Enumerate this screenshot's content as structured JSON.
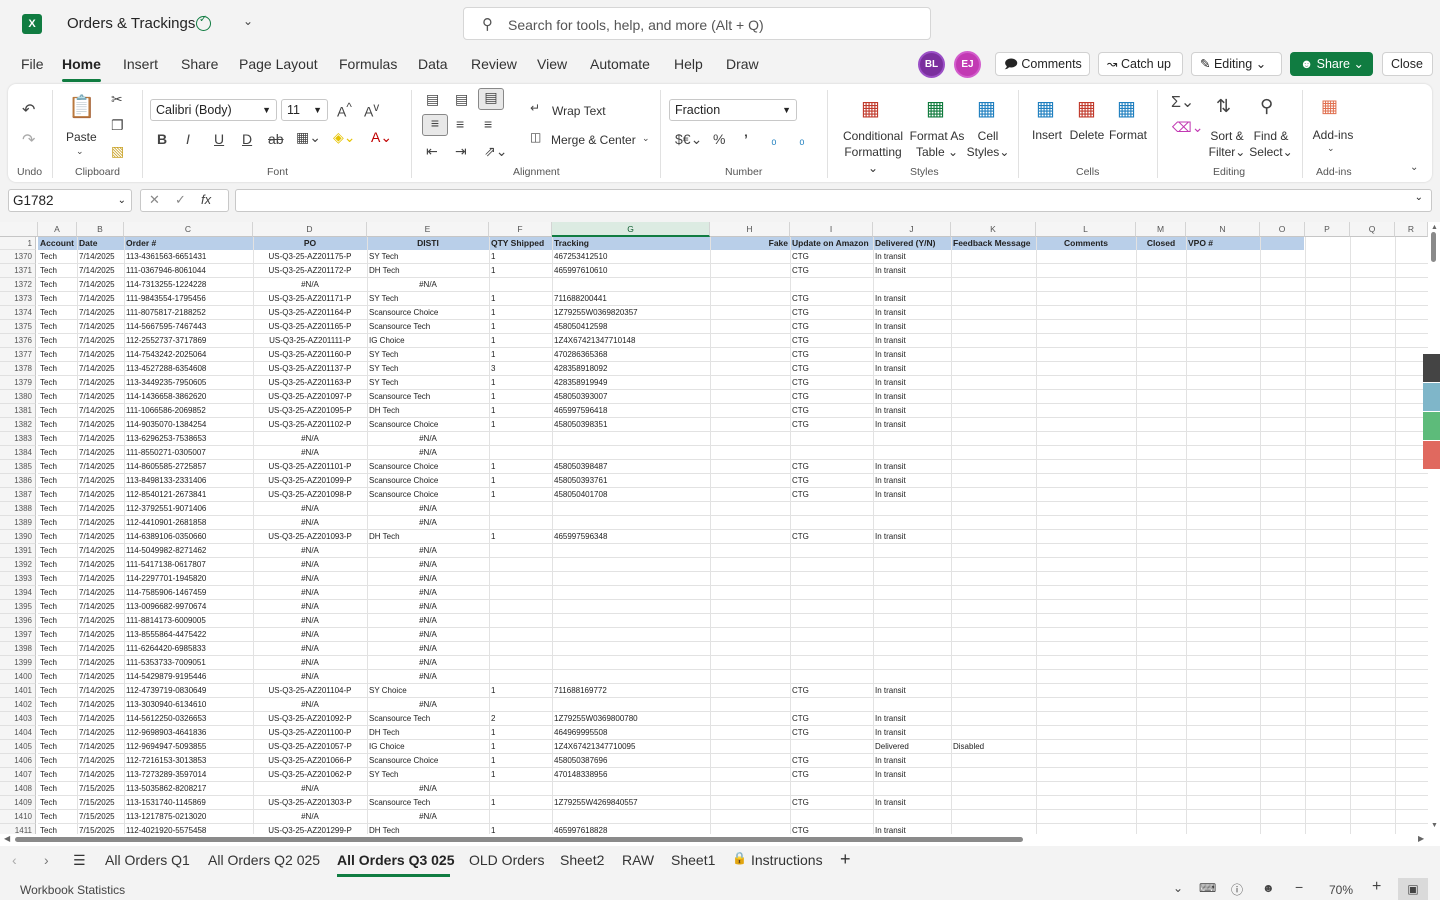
{
  "app": {
    "title": "Orders & Trackings",
    "logo": "X"
  },
  "search": {
    "placeholder": "Search for tools, help, and more (Alt + Q)"
  },
  "menu": [
    "File",
    "Home",
    "Insert",
    "Share",
    "Page Layout",
    "Formulas",
    "Data",
    "Review",
    "View",
    "Automate",
    "Help",
    "Draw"
  ],
  "active_menu": "Home",
  "avatars": [
    "BL",
    "EJ"
  ],
  "top_buttons": {
    "comments": "Comments",
    "catchup": "Catch up",
    "editing": "Editing",
    "share": "Share",
    "close": "Close"
  },
  "ribbon": {
    "undo_group": "Undo",
    "clipboard": {
      "paste": "Paste",
      "group": "Clipboard"
    },
    "font": {
      "name": "Calibri (Body)",
      "size": "11",
      "group": "Font"
    },
    "alignment": {
      "wrap": "Wrap Text",
      "merge": "Merge & Center",
      "group": "Alignment"
    },
    "number": {
      "format": "Fraction",
      "group": "Number"
    },
    "styles": {
      "conditional": "Conditional",
      "conditional2": "Formatting",
      "format_as": "Format As",
      "format_as2": "Table",
      "cell": "Cell",
      "cell2": "Styles",
      "group": "Styles"
    },
    "cells": {
      "insert": "Insert",
      "delete": "Delete",
      "format": "Format",
      "group": "Cells"
    },
    "editing": {
      "sort": "Sort &",
      "sort2": "Filter",
      "find": "Find &",
      "find2": "Select",
      "group": "Editing"
    },
    "addins": {
      "label": "Add-ins",
      "group": "Add-ins"
    }
  },
  "namebox": "G1782",
  "fx": "fx",
  "columns": [
    "A",
    "B",
    "C",
    "D",
    "E",
    "F",
    "G",
    "H",
    "I",
    "J",
    "K",
    "L",
    "M",
    "N",
    "O",
    "P",
    "Q",
    "R"
  ],
  "header_row": {
    "num": "1",
    "cells": [
      "Account",
      "Date",
      "Order #",
      "PO",
      "DISTI",
      "QTY Shipped",
      "Tracking",
      "Fake",
      "Update on Amazon",
      "Delivered (Y/N)",
      "Feedback Message",
      "Comments",
      "Closed",
      "VPO #"
    ]
  },
  "rows": [
    [
      "1370",
      "Tech",
      "7/14/2025",
      "113-4361563-6651431",
      "US-Q3-25-AZ201175-P",
      "SY Tech",
      "1",
      "467253412510",
      "CTG",
      "In transit",
      ""
    ],
    [
      "1371",
      "Tech",
      "7/14/2025",
      "111-0367946-8061044",
      "US-Q3-25-AZ201172-P",
      "DH Tech",
      "1",
      "465997610610",
      "CTG",
      "In transit",
      ""
    ],
    [
      "1372",
      "Tech",
      "7/14/2025",
      "114-7313255-1224228",
      "#N/A",
      "#N/A",
      "",
      "",
      "",
      "",
      ""
    ],
    [
      "1373",
      "Tech",
      "7/14/2025",
      "111-9843554-1795456",
      "US-Q3-25-AZ201171-P",
      "SY Tech",
      "1",
      "711688200441",
      "CTG",
      "In transit",
      ""
    ],
    [
      "1374",
      "Tech",
      "7/14/2025",
      "111-8075817-2188252",
      "US-Q3-25-AZ201164-P",
      "Scansource Choice",
      "1",
      "1Z79255W0369820357",
      "CTG",
      "In transit",
      ""
    ],
    [
      "1375",
      "Tech",
      "7/14/2025",
      "114-5667595-7467443",
      "US-Q3-25-AZ201165-P",
      "Scansource Tech",
      "1",
      "458050412598",
      "CTG",
      "In transit",
      ""
    ],
    [
      "1376",
      "Tech",
      "7/14/2025",
      "112-2552737-3717869",
      "US-Q3-25-AZ201111-P",
      "IG Choice",
      "1",
      "1Z4X67421347710148",
      "CTG",
      "In transit",
      ""
    ],
    [
      "1377",
      "Tech",
      "7/14/2025",
      "114-7543242-2025064",
      "US-Q3-25-AZ201160-P",
      "SY Tech",
      "1",
      "470286365368",
      "CTG",
      "In transit",
      ""
    ],
    [
      "1378",
      "Tech",
      "7/14/2025",
      "113-4527288-6354608",
      "US-Q3-25-AZ201137-P",
      "SY Tech",
      "3",
      "428358918092",
      "CTG",
      "In transit",
      ""
    ],
    [
      "1379",
      "Tech",
      "7/14/2025",
      "113-3449235-7950605",
      "US-Q3-25-AZ201163-P",
      "SY Tech",
      "1",
      "428358919949",
      "CTG",
      "In transit",
      ""
    ],
    [
      "1380",
      "Tech",
      "7/14/2025",
      "114-1436658-3862620",
      "US-Q3-25-AZ201097-P",
      "Scansource Tech",
      "1",
      "458050393007",
      "CTG",
      "In transit",
      ""
    ],
    [
      "1381",
      "Tech",
      "7/14/2025",
      "111-1066586-2069852",
      "US-Q3-25-AZ201095-P",
      "DH Tech",
      "1",
      "465997596418",
      "CTG",
      "In transit",
      ""
    ],
    [
      "1382",
      "Tech",
      "7/14/2025",
      "114-9035070-1384254",
      "US-Q3-25-AZ201102-P",
      "Scansource Choice",
      "1",
      "458050398351",
      "CTG",
      "In transit",
      ""
    ],
    [
      "1383",
      "Tech",
      "7/14/2025",
      "113-6296253-7538653",
      "#N/A",
      "#N/A",
      "",
      "",
      "",
      "",
      ""
    ],
    [
      "1384",
      "Tech",
      "7/14/2025",
      "111-8550271-0305007",
      "#N/A",
      "#N/A",
      "",
      "",
      "",
      "",
      ""
    ],
    [
      "1385",
      "Tech",
      "7/14/2025",
      "114-8605585-2725857",
      "US-Q3-25-AZ201101-P",
      "Scansource Choice",
      "1",
      "458050398487",
      "CTG",
      "In transit",
      ""
    ],
    [
      "1386",
      "Tech",
      "7/14/2025",
      "113-8498133-2331406",
      "US-Q3-25-AZ201099-P",
      "Scansource Choice",
      "1",
      "458050393761",
      "CTG",
      "In transit",
      ""
    ],
    [
      "1387",
      "Tech",
      "7/14/2025",
      "112-8540121-2673841",
      "US-Q3-25-AZ201098-P",
      "Scansource Choice",
      "1",
      "458050401708",
      "CTG",
      "In transit",
      ""
    ],
    [
      "1388",
      "Tech",
      "7/14/2025",
      "112-3792551-9071406",
      "#N/A",
      "#N/A",
      "",
      "",
      "",
      "",
      ""
    ],
    [
      "1389",
      "Tech",
      "7/14/2025",
      "112-4410901-2681858",
      "#N/A",
      "#N/A",
      "",
      "",
      "",
      "",
      ""
    ],
    [
      "1390",
      "Tech",
      "7/14/2025",
      "114-6389106-0350660",
      "US-Q3-25-AZ201093-P",
      "DH Tech",
      "1",
      "465997596348",
      "CTG",
      "In transit",
      ""
    ],
    [
      "1391",
      "Tech",
      "7/14/2025",
      "114-5049982-8271462",
      "#N/A",
      "#N/A",
      "",
      "",
      "",
      "",
      ""
    ],
    [
      "1392",
      "Tech",
      "7/14/2025",
      "111-5417138-0617807",
      "#N/A",
      "#N/A",
      "",
      "",
      "",
      "",
      ""
    ],
    [
      "1393",
      "Tech",
      "7/14/2025",
      "114-2297701-1945820",
      "#N/A",
      "#N/A",
      "",
      "",
      "",
      "",
      ""
    ],
    [
      "1394",
      "Tech",
      "7/14/2025",
      "114-7585906-1467459",
      "#N/A",
      "#N/A",
      "",
      "",
      "",
      "",
      ""
    ],
    [
      "1395",
      "Tech",
      "7/14/2025",
      "113-0096682-9970674",
      "#N/A",
      "#N/A",
      "",
      "",
      "",
      "",
      ""
    ],
    [
      "1396",
      "Tech",
      "7/14/2025",
      "111-8814173-6009005",
      "#N/A",
      "#N/A",
      "",
      "",
      "",
      "",
      ""
    ],
    [
      "1397",
      "Tech",
      "7/14/2025",
      "113-8555864-4475422",
      "#N/A",
      "#N/A",
      "",
      "",
      "",
      "",
      ""
    ],
    [
      "1398",
      "Tech",
      "7/14/2025",
      "111-6264420-6985833",
      "#N/A",
      "#N/A",
      "",
      "",
      "",
      "",
      ""
    ],
    [
      "1399",
      "Tech",
      "7/14/2025",
      "111-5353733-7009051",
      "#N/A",
      "#N/A",
      "",
      "",
      "",
      "",
      ""
    ],
    [
      "1400",
      "Tech",
      "7/14/2025",
      "114-5429879-9195446",
      "#N/A",
      "#N/A",
      "",
      "",
      "",
      "",
      ""
    ],
    [
      "1401",
      "Tech",
      "7/14/2025",
      "112-4739719-0830649",
      "US-Q3-25-AZ201104-P",
      "SY Choice",
      "1",
      "711688169772",
      "CTG",
      "In transit",
      ""
    ],
    [
      "1402",
      "Tech",
      "7/14/2025",
      "113-3030940-6134610",
      "#N/A",
      "#N/A",
      "",
      "",
      "",
      "",
      ""
    ],
    [
      "1403",
      "Tech",
      "7/14/2025",
      "114-5612250-0326653",
      "US-Q3-25-AZ201092-P",
      "Scansource Tech",
      "2",
      "1Z79255W0369800780",
      "CTG",
      "In transit",
      ""
    ],
    [
      "1404",
      "Tech",
      "7/14/2025",
      "112-9698903-4641836",
      "US-Q3-25-AZ201100-P",
      "DH Tech",
      "1",
      "464969995508",
      "CTG",
      "In transit",
      ""
    ],
    [
      "1405",
      "Tech",
      "7/14/2025",
      "112-9694947-5093855",
      "US-Q3-25-AZ201057-P",
      "IG Choice",
      "1",
      "1Z4X67421347710095",
      "",
      "Delivered",
      "Disabled"
    ],
    [
      "1406",
      "Tech",
      "7/14/2025",
      "112-7216153-3013853",
      "US-Q3-25-AZ201066-P",
      "Scansource Choice",
      "1",
      "458050387696",
      "CTG",
      "In transit",
      ""
    ],
    [
      "1407",
      "Tech",
      "7/14/2025",
      "113-7273289-3597014",
      "US-Q3-25-AZ201062-P",
      "SY Tech",
      "1",
      "470148338956",
      "CTG",
      "In transit",
      ""
    ],
    [
      "1408",
      "Tech",
      "7/15/2025",
      "113-5035862-8208217",
      "#N/A",
      "#N/A",
      "",
      "",
      "",
      "",
      ""
    ],
    [
      "1409",
      "Tech",
      "7/15/2025",
      "113-1531740-1145869",
      "US-Q3-25-AZ201303-P",
      "Scansource Tech",
      "1",
      "1Z79255W4269840557",
      "CTG",
      "In transit",
      ""
    ],
    [
      "1410",
      "Tech",
      "7/15/2025",
      "113-1217875-0213020",
      "#N/A",
      "#N/A",
      "",
      "",
      "",
      "",
      ""
    ],
    [
      "1411",
      "Tech",
      "7/15/2025",
      "112-4021920-5575458",
      "US-Q3-25-AZ201299-P",
      "DH Tech",
      "1",
      "465997618828",
      "CTG",
      "In transit",
      ""
    ]
  ],
  "sheet_tabs": [
    "All Orders Q1",
    "All Orders Q2 025",
    "All Orders Q3 025",
    "OLD Orders",
    "Sheet2",
    "RAW",
    "Sheet1",
    "Instructions"
  ],
  "active_sheet": "All Orders Q3 025",
  "status": {
    "left": "Workbook Statistics",
    "zoom": "70%"
  }
}
